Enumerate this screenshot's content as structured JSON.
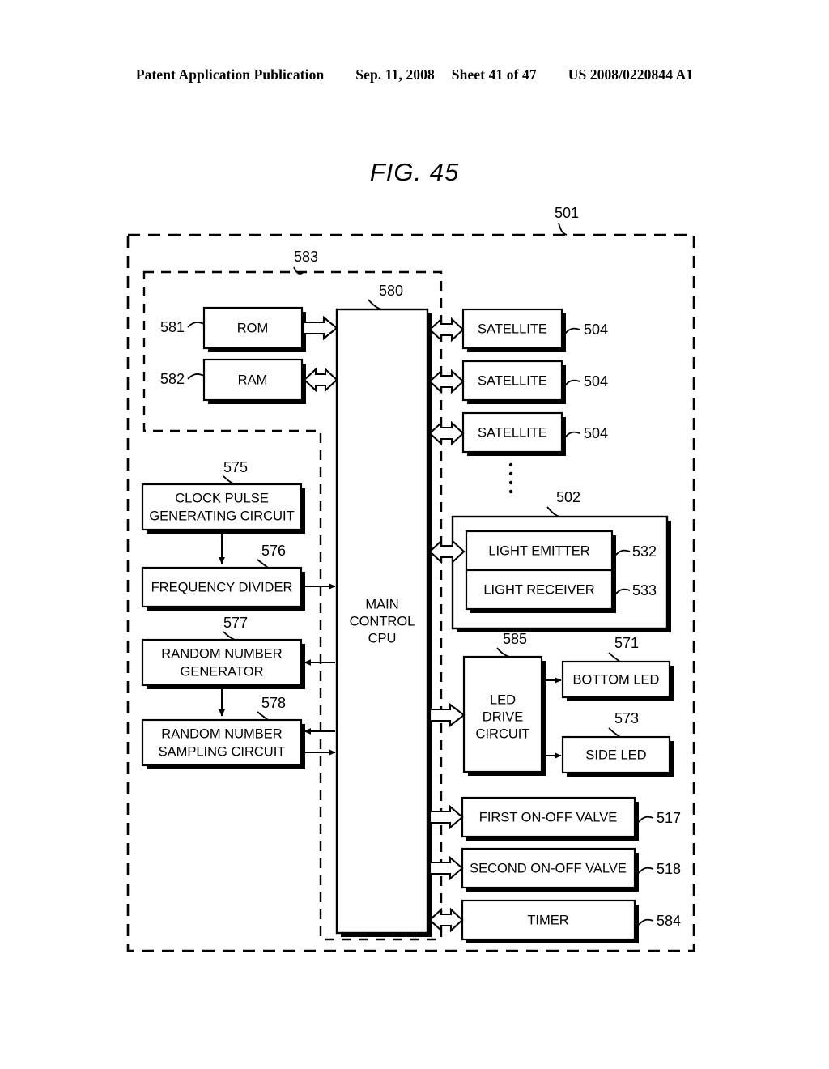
{
  "header": {
    "publication": "Patent Application Publication",
    "date": "Sep. 11, 2008",
    "sheet": "Sheet 41 of 47",
    "patent_number": "US 2008/0220844 A1"
  },
  "figure": {
    "title": "FIG. 45"
  },
  "refs": {
    "outer": "501",
    "inner": "583",
    "cpu": "580",
    "rom": "581",
    "ram": "582",
    "satellite1": "504",
    "satellite2": "504",
    "satellite3": "504",
    "sensor_unit": "502",
    "light_emitter": "532",
    "light_receiver": "533",
    "clock_pulse": "575",
    "freq_divider": "576",
    "rng": "577",
    "rn_sampling": "578",
    "led_drive": "585",
    "bottom_led": "571",
    "side_led": "573",
    "first_valve": "517",
    "second_valve": "518",
    "timer": "584"
  },
  "blocks": {
    "rom": "ROM",
    "ram": "RAM",
    "cpu_line1": "MAIN",
    "cpu_line2": "CONTROL",
    "cpu_line3": "CPU",
    "satellite1": "SATELLITE",
    "satellite2": "SATELLITE",
    "satellite3": "SATELLITE",
    "light_emitter": "LIGHT EMITTER",
    "light_receiver": "LIGHT RECEIVER",
    "clock_pulse_line1": "CLOCK PULSE",
    "clock_pulse_line2": "GENERATING CIRCUIT",
    "freq_divider": "FREQUENCY DIVIDER",
    "rng_line1": "RANDOM NUMBER",
    "rng_line2": "GENERATOR",
    "rn_sampling_line1": "RANDOM NUMBER",
    "rn_sampling_line2": "SAMPLING CIRCUIT",
    "led_drive_line1": "LED",
    "led_drive_line2": "DRIVE",
    "led_drive_line3": "CIRCUIT",
    "bottom_led": "BOTTOM LED",
    "side_led": "SIDE LED",
    "first_valve": "FIRST ON-OFF VALVE",
    "second_valve": "SECOND ON-OFF VALVE",
    "timer": "TIMER"
  },
  "colors": {
    "ink": "#000000",
    "paper": "#ffffff"
  }
}
